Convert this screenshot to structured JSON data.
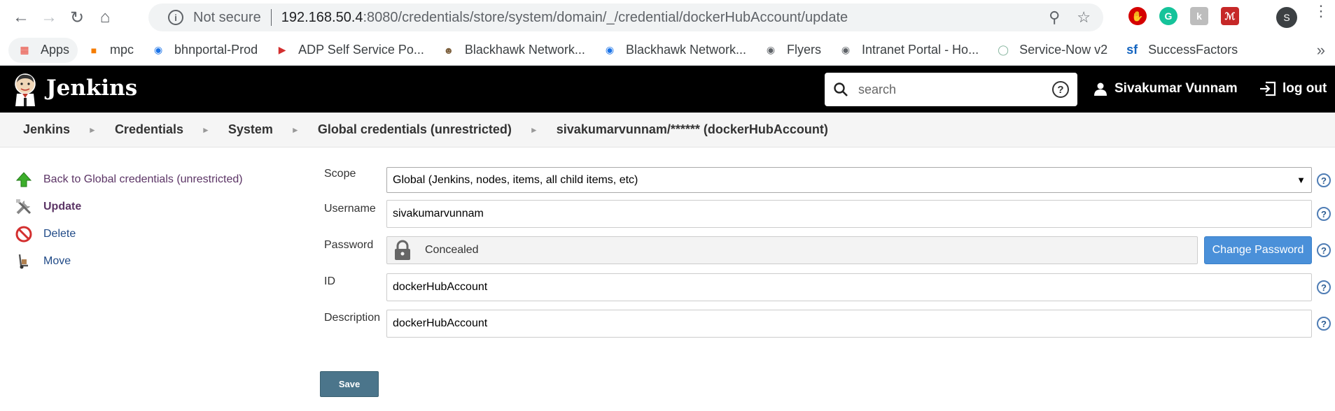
{
  "browser": {
    "not_secure": "Not secure",
    "url_host": "192.168.50.4",
    "url_rest": ":8080/credentials/store/system/domain/_/credential/dockerHubAccount/update",
    "profile_initial": "S"
  },
  "bookmarks": [
    {
      "label": "Apps",
      "icon": "apps-grid-icon",
      "color": "#ea4335"
    },
    {
      "label": "mpc",
      "icon": "cube-icon",
      "color": "#f57c00"
    },
    {
      "label": "bhnportal-Prod",
      "icon": "circle-icon",
      "color": "#1a73e8"
    },
    {
      "label": "ADP Self Service Po...",
      "icon": "adp-icon",
      "color": "#d32f2f"
    },
    {
      "label": "Blackhawk Network...",
      "icon": "avatar-icon",
      "color": "#7b5e3b"
    },
    {
      "label": "Blackhawk Network...",
      "icon": "circle-icon",
      "color": "#1a73e8"
    },
    {
      "label": "Flyers",
      "icon": "globe-icon",
      "color": "#5f6368"
    },
    {
      "label": "Intranet Portal - Ho...",
      "icon": "globe-icon",
      "color": "#5f6368"
    },
    {
      "label": "Service-Now v2",
      "icon": "ring-icon",
      "color": "#81b29a"
    },
    {
      "label": "SuccessFactors",
      "icon": "sf-icon",
      "color": "#1565c0"
    }
  ],
  "jenkins": {
    "title": "Jenkins",
    "search_placeholder": "search",
    "user": "Sivakumar Vunnam",
    "logout": "log out"
  },
  "breadcrumb": [
    "Jenkins",
    "Credentials",
    "System",
    "Global credentials (unrestricted)",
    "sivakumarvunnam/****** (dockerHubAccount)"
  ],
  "side": {
    "back": "Back to Global credentials (unrestricted)",
    "update": "Update",
    "delete": "Delete",
    "move": "Move"
  },
  "form": {
    "scope_label": "Scope",
    "scope_value": "Global (Jenkins, nodes, items, all child items, etc)",
    "username_label": "Username",
    "username_value": "sivakumarvunnam",
    "password_label": "Password",
    "password_value": "Concealed",
    "change_password": "Change Password",
    "id_label": "ID",
    "id_value": "dockerHubAccount",
    "description_label": "Description",
    "description_value": "dockerHubAccount",
    "save": "Save",
    "help": "?"
  }
}
